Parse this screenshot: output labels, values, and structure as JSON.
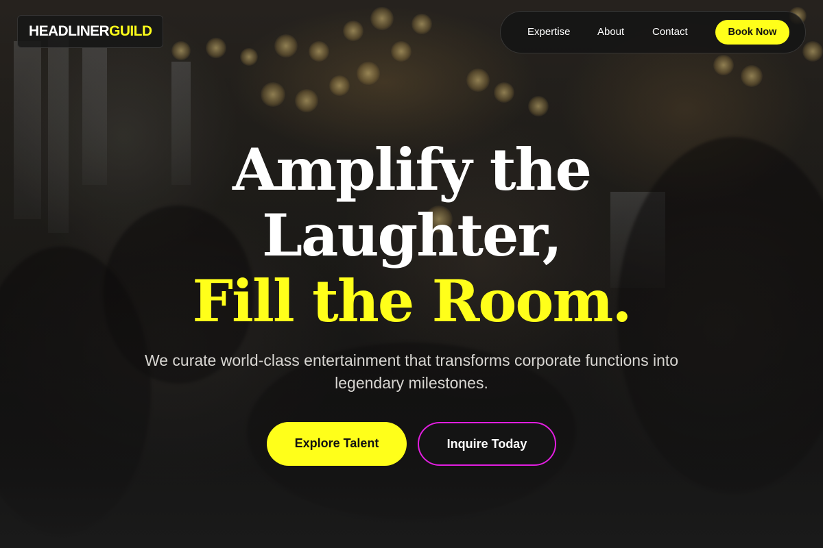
{
  "brand": {
    "name_part1": "HEADLINER",
    "name_part2": "GUILD"
  },
  "nav": {
    "links": [
      {
        "label": "Expertise"
      },
      {
        "label": "About"
      },
      {
        "label": "Contact"
      }
    ],
    "cta_label": "Book Now"
  },
  "hero": {
    "title_line1": "Amplify the",
    "title_line2": "Laughter,",
    "title_line3": "Fill the Room.",
    "subtitle": "We curate world-class entertainment that transforms corporate functions into legendary milestones.",
    "primary_button": "Explore Talent",
    "secondary_button": "Inquire Today"
  },
  "colors": {
    "accent_yellow": "#ffff1a",
    "accent_magenta": "#e21ee0",
    "background_dark": "#1a1a1a",
    "text_white": "#ffffff"
  }
}
